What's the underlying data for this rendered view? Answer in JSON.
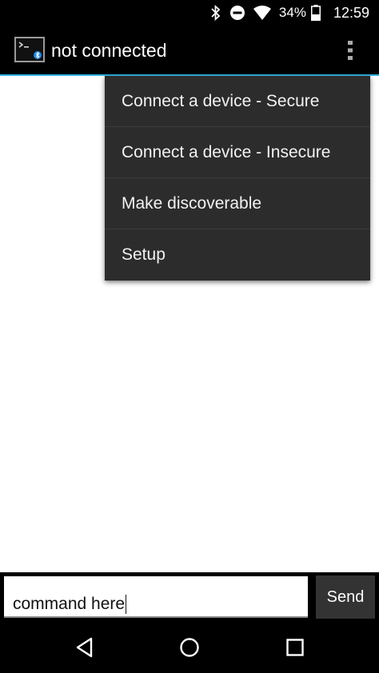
{
  "status_bar": {
    "battery_percent": "34%",
    "time": "12:59",
    "icons": [
      "bluetooth-icon",
      "do-not-disturb-icon",
      "wifi-icon",
      "battery-icon"
    ]
  },
  "action_bar": {
    "title": "not connected",
    "app_icon": "bluetooth-terminal-icon",
    "overflow_icon": "more-vert-icon"
  },
  "menu": {
    "items": [
      {
        "label": "Connect a device - Secure"
      },
      {
        "label": "Connect a device - Insecure"
      },
      {
        "label": "Make discoverable"
      },
      {
        "label": "Setup"
      }
    ]
  },
  "input": {
    "value": "command here",
    "send_label": "Send"
  },
  "nav_bar": {
    "icons": [
      "back-icon",
      "home-icon",
      "recents-icon"
    ]
  },
  "colors": {
    "action_bar_accent": "#33b5e5",
    "menu_background": "#2c2c2c",
    "send_button": "#333333"
  }
}
